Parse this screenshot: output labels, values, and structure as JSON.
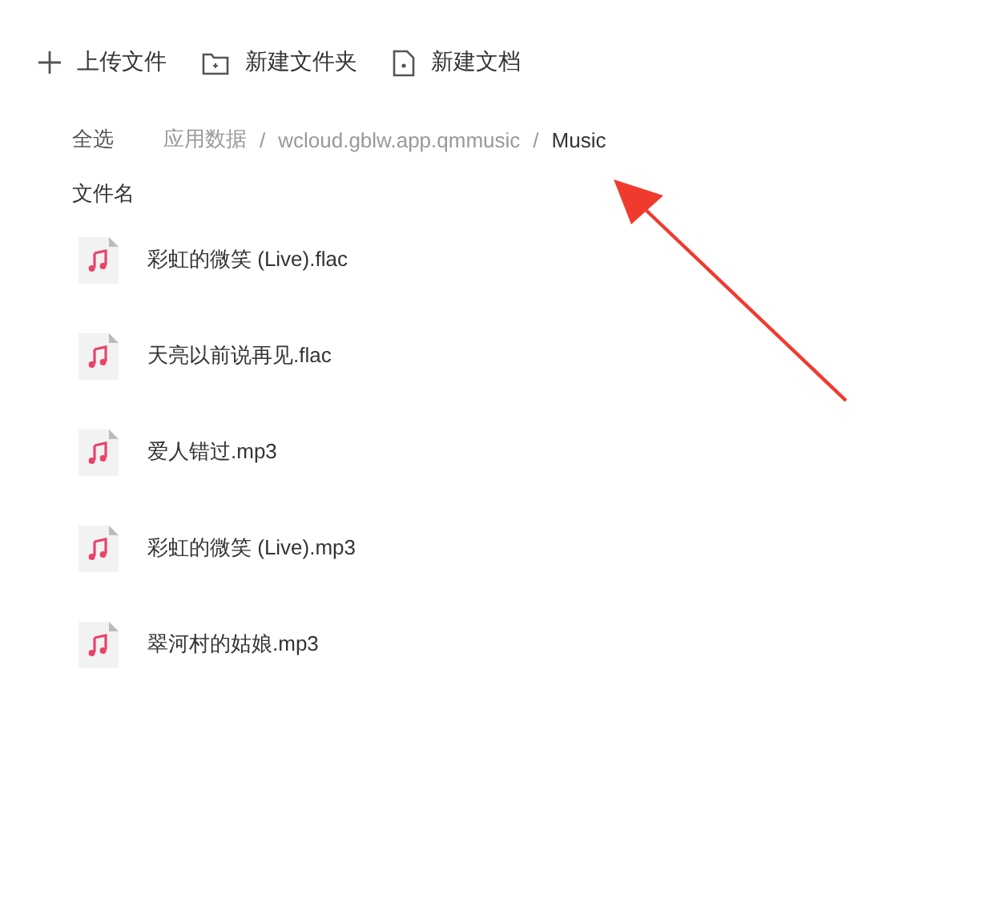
{
  "toolbar": [
    {
      "kind": "upload",
      "label": "上传文件"
    },
    {
      "kind": "folder",
      "label": "新建文件夹"
    },
    {
      "kind": "document",
      "label": "新建文档"
    }
  ],
  "select_all": "全选",
  "breadcrumb": [
    {
      "label": "应用数据",
      "current": false,
      "separator": "/"
    },
    {
      "label": "wcloud.gblw.app.qmmusic",
      "current": false,
      "separator": "/"
    },
    {
      "label": "Music",
      "current": true
    }
  ],
  "column_header": "文件名",
  "files": [
    {
      "name": "彩虹的微笑 (Live).flac"
    },
    {
      "name": "天亮以前说再见.flac"
    },
    {
      "name": "爱人错过.mp3"
    },
    {
      "name": "彩虹的微笑 (Live).mp3"
    },
    {
      "name": "翠河村的姑娘.mp3"
    }
  ],
  "annotation": {
    "kind": "arrow"
  }
}
